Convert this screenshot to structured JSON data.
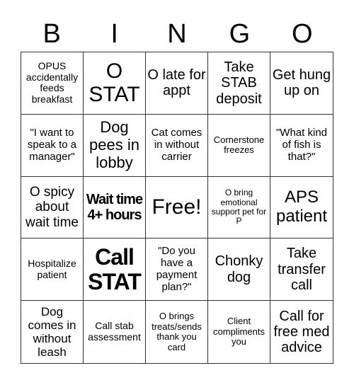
{
  "header": {
    "letters": [
      "B",
      "I",
      "N",
      "G",
      "O"
    ]
  },
  "cells": [
    "OPUS accidentally feeds breakfast",
    "O STAT",
    "O late for appt",
    "Take STAB deposit",
    "Get hung up on",
    "\"I want to speak to a manager\"",
    "Dog pees in lobby",
    "Cat comes in without carrier",
    "Cornerstone freezes",
    "\"What kind of fish is that?\"",
    "O spicy about wait time",
    "Wait time 4+ hours",
    "Free!",
    "O bring emotional support pet for P",
    "APS patient",
    "Hospitalize patient",
    "Call STAT",
    "\"Do you have a payment plan?\"",
    "Chonky dog",
    "Take transfer call",
    "Dog comes in without leash",
    "Call stab assessment",
    "O brings treats/sends thank you card",
    "Client compliments you",
    "Call for free med advice"
  ]
}
